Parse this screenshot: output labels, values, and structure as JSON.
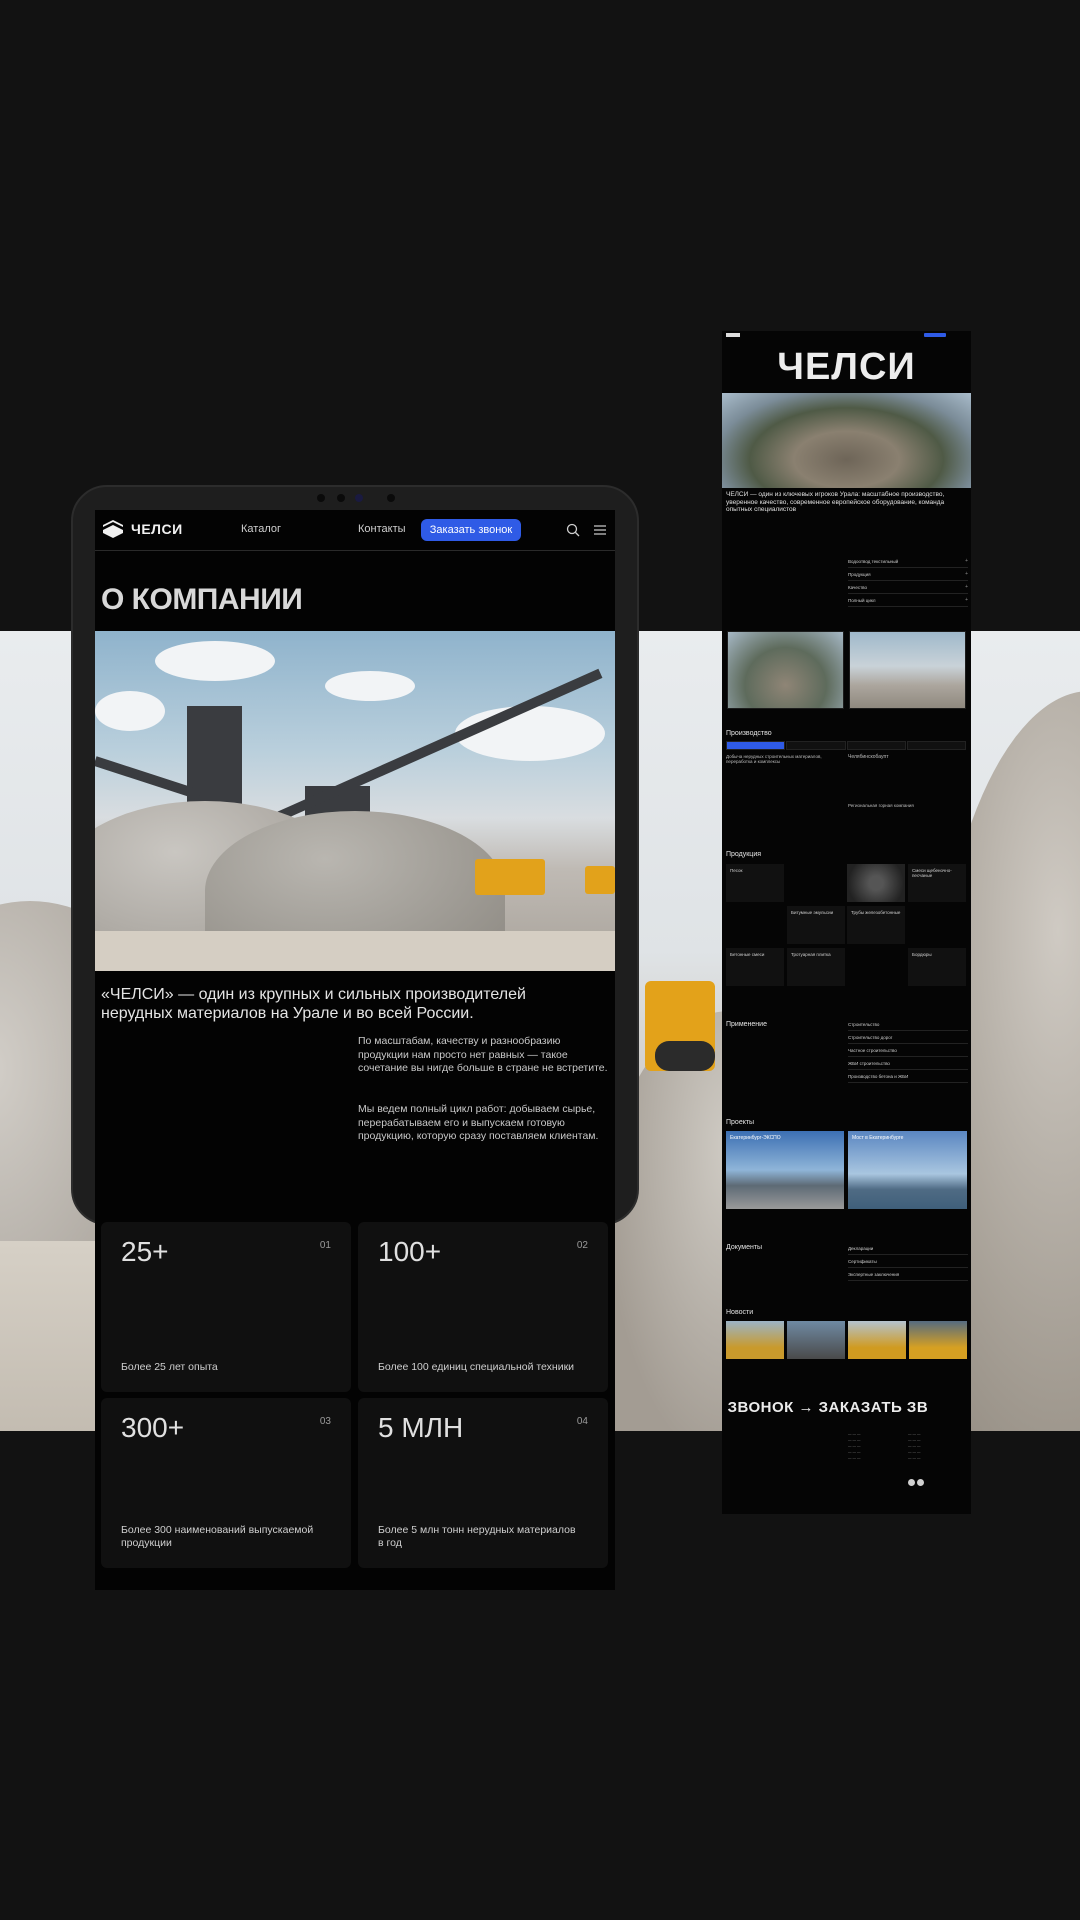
{
  "brand": {
    "name": "ЧЕЛСИ"
  },
  "tablet": {
    "nav": {
      "catalog": "Каталог",
      "contacts": "Контакты",
      "cta": "Заказать звонок"
    },
    "title": "О КОМПАНИИ",
    "lead": "«ЧЕЛСИ» — один из крупных и сильных производителей нерудных материалов на Урале и во всей России.",
    "para1": "По масштабам, качеству и разнообразию продукции нам просто нет равных — такое сочетание вы нигде больше в стране не встретите.",
    "para2": "Мы ведем полный цикл работ: добываем сырье, перерабатываем его и выпускаем готовую продукцию, которую сразу поставляем клиентам.",
    "stats": [
      {
        "value": "25+",
        "num": "01",
        "caption": "Более 25 лет опыта"
      },
      {
        "value": "100+",
        "num": "02",
        "caption": "Более 100 единиц специальной техники"
      },
      {
        "value": "300+",
        "num": "03",
        "caption": "Более 300 наименований выпускаемой продукции"
      },
      {
        "value": "5 МЛН",
        "num": "04",
        "caption": "Более 5 млн тонн нерудных материалов в год"
      }
    ]
  },
  "page": {
    "hero_text": "ЧЕЛСИ — один из ключевых игроков Урала: масштабное производство, уверенное качество, современное европейское оборудование, команда опытных специалистов",
    "accordion": [
      "Водоотвод текстильный",
      "Продукция",
      "Качество",
      "Полный цикл"
    ],
    "production_title": "Производство",
    "production_lead": "Добыча нерудных строительных материалов, переработка и комплексы",
    "production_sub1": "Челябинскобаупт",
    "production_sub2": "Региональная горная компания",
    "products_title": "Продукция",
    "products": [
      "Песок",
      "Смеси щебеночно-песчаные",
      "Битумные эмульсии",
      "Трубы железобетонные",
      "Бетонные смеси",
      "Тротуарная плитка",
      "Бордюры"
    ],
    "applications_title": "Применение",
    "applications": [
      "Строительство",
      "Строительство дорог",
      "Частное строительство",
      "ЖБИ строительство",
      "Производство бетона и ЖБИ"
    ],
    "projects_title": "Проекты",
    "projects": [
      "Екатеринбург-ЭКСПО",
      "Мост в Екатеринбурге"
    ],
    "documents_title": "Документы",
    "documents": [
      "Декларации",
      "Сертификаты",
      "Экспертные заключения"
    ],
    "news_title": "Новости",
    "cta_marquee": "ТЬ ЗВОНОК → ЗАКАЗАТЬ ЗВ"
  }
}
